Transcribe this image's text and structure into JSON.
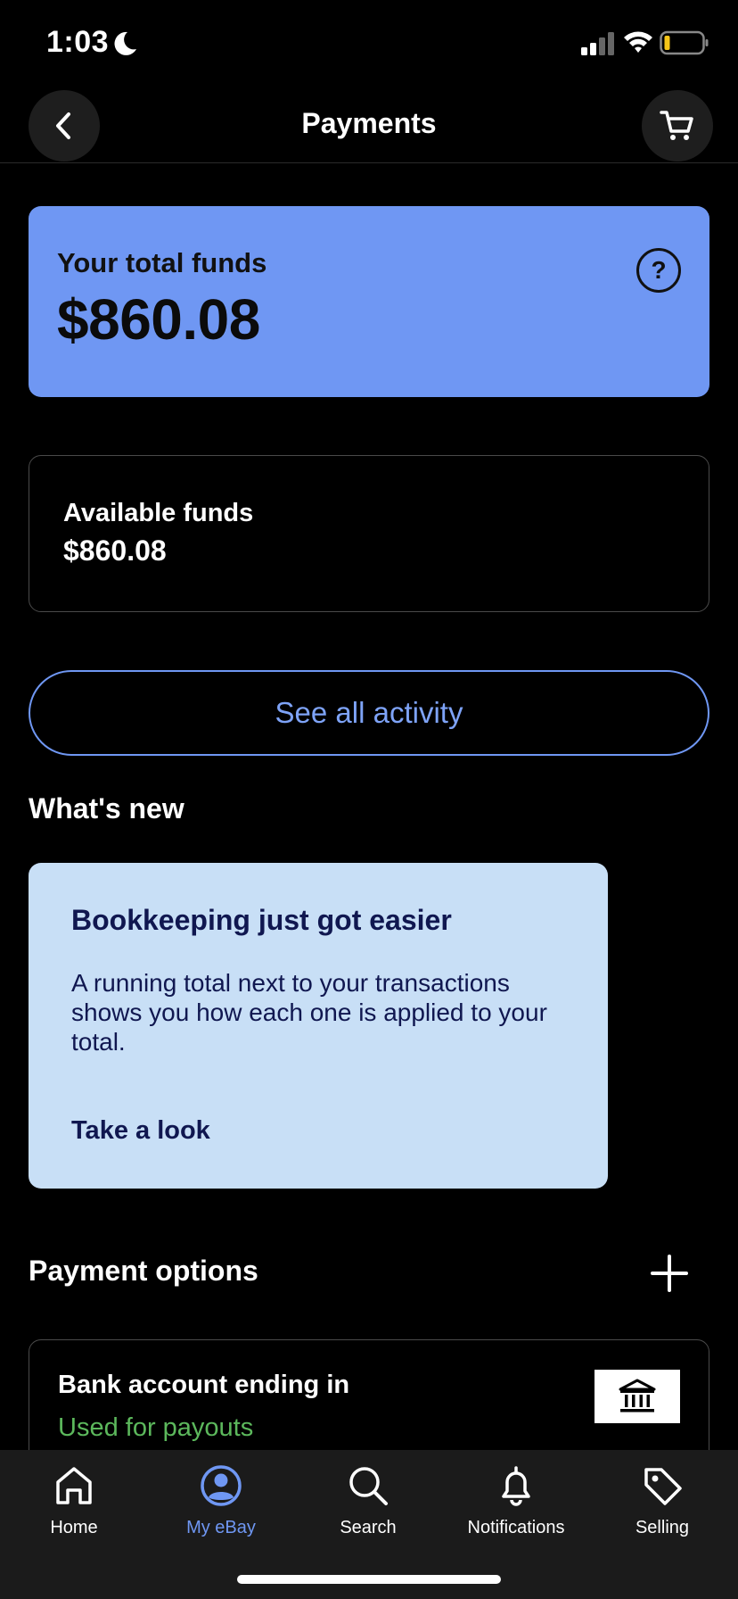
{
  "status_bar": {
    "time": "1:03",
    "icons": [
      "moon-icon",
      "cellular-signal-icon",
      "wifi-icon",
      "battery-low-icon"
    ]
  },
  "header": {
    "title": "Payments",
    "back_icon": "chevron-left-icon",
    "cart_icon": "cart-icon"
  },
  "total_funds": {
    "label": "Your total funds",
    "amount": "$860.08",
    "help_glyph": "?",
    "color": "#6f97f3"
  },
  "available_funds": {
    "label": "Available funds",
    "amount": "$860.08"
  },
  "see_all_activity": {
    "label": "See all activity",
    "color": "#6f97f3"
  },
  "whats_new": {
    "heading": "What's new",
    "card": {
      "title": "Bookkeeping just got easier",
      "body": "A running total next to your transactions shows you how each one is applied to your total.",
      "link": "Take a look",
      "background": "#c8dff6"
    }
  },
  "payment_options": {
    "heading": "Payment options",
    "add_icon": "plus-icon",
    "items": [
      {
        "label": "Bank account ending in",
        "status": "Used for payouts",
        "status_color": "#5cb85c",
        "icon": "bank-icon"
      }
    ]
  },
  "tab_bar": {
    "active_color": "#6f97f3",
    "tabs": [
      {
        "label": "Home",
        "icon": "home-icon",
        "active": false
      },
      {
        "label": "My eBay",
        "icon": "profile-icon",
        "active": true
      },
      {
        "label": "Search",
        "icon": "search-icon",
        "active": false
      },
      {
        "label": "Notifications",
        "icon": "bell-icon",
        "active": false
      },
      {
        "label": "Selling",
        "icon": "tag-icon",
        "active": false
      }
    ]
  }
}
